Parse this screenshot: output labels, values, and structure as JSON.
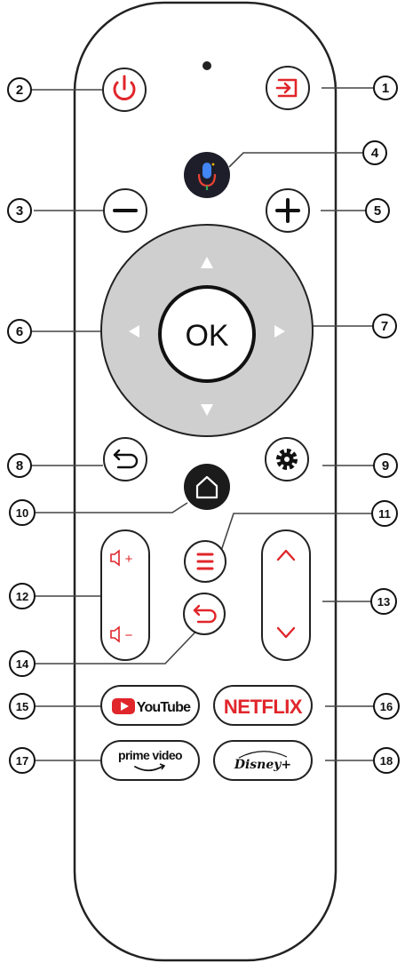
{
  "callouts": [
    "1",
    "2",
    "3",
    "4",
    "5",
    "6",
    "7",
    "8",
    "9",
    "10",
    "11",
    "12",
    "13",
    "14",
    "15",
    "16",
    "17",
    "18"
  ],
  "buttons": {
    "ok_label": "OK",
    "youtube_label": "YouTube",
    "netflix_label": "NETFLIX",
    "prime_label": "prime video",
    "disney_label": "Disney+",
    "volume_up_label": "+",
    "volume_down_label": "−"
  },
  "colors": {
    "accent_red": "#e0262b",
    "body_outline": "#222222",
    "dpad_ring": "#cfcfcf",
    "assistant_bg": "#1e1e2a",
    "home_bg": "#1b1b1b"
  },
  "icons": {
    "power": "power-icon",
    "input": "input-source-icon",
    "mic": "microphone-icon",
    "minus": "minus-icon",
    "plus": "plus-icon",
    "back": "back-icon",
    "settings": "gear-icon",
    "home": "home-icon",
    "menu": "menu-icon",
    "channel_up": "chevron-up-icon",
    "channel_down": "chevron-down-icon"
  }
}
